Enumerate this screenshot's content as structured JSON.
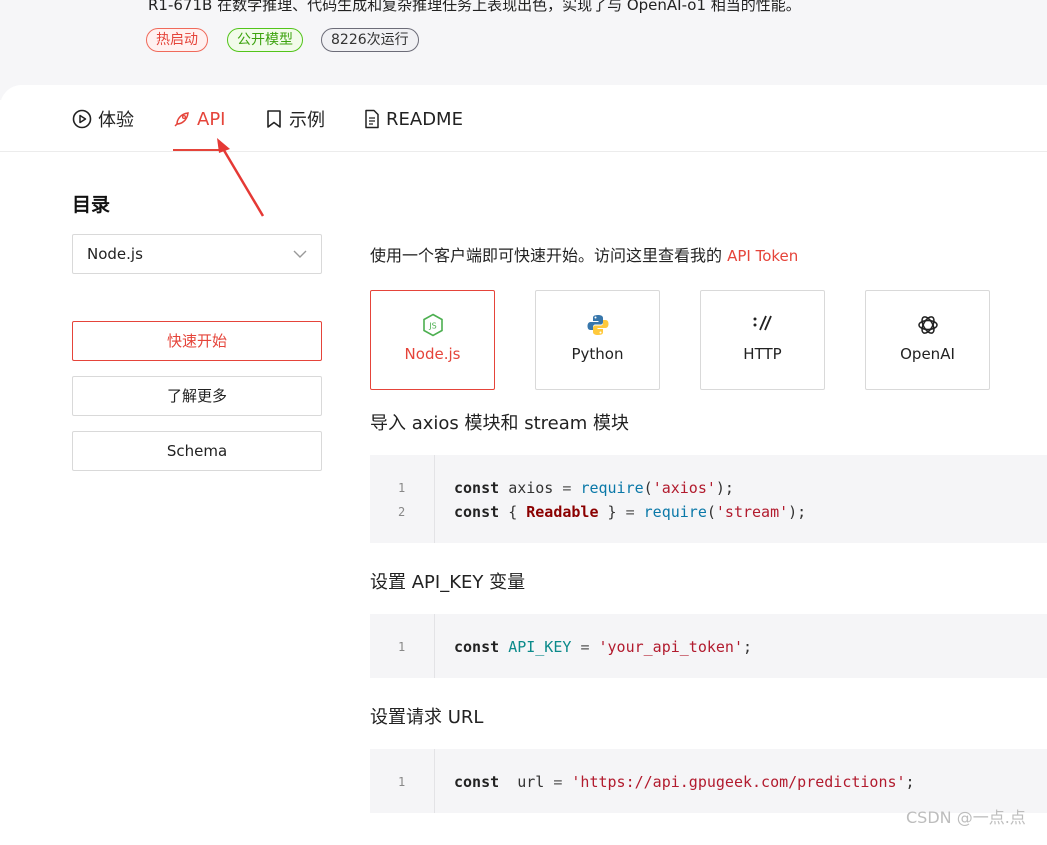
{
  "header": {
    "description": "R1-671B 在数学推理、代码生成和复杂推理任务上表现出色，实现了与 OpenAI-o1 相当的性能。",
    "badges": [
      "热启动",
      "公开模型",
      "8226次运行"
    ]
  },
  "tabs": [
    {
      "label": "体验",
      "icon": "play-circle-icon"
    },
    {
      "label": "API",
      "icon": "rocket-icon",
      "active": true
    },
    {
      "label": "示例",
      "icon": "bookmark-icon"
    },
    {
      "label": "README",
      "icon": "document-icon"
    }
  ],
  "sidebar": {
    "title": "目录",
    "select_value": "Node.js",
    "items": [
      "快速开始",
      "了解更多",
      "Schema"
    ]
  },
  "main": {
    "intro": "使用一个客户端即可快速开始。访问这里查看我的",
    "intro_link": "API Token",
    "languages": [
      {
        "label": "Node.js",
        "icon": "nodejs-icon",
        "active": true
      },
      {
        "label": "Python",
        "icon": "python-icon"
      },
      {
        "label": "HTTP",
        "icon": "http-icon"
      },
      {
        "label": "OpenAI",
        "icon": "openai-icon"
      }
    ],
    "sections": [
      {
        "title": "导入 axios 模块和 stream 模块",
        "lines": [
          [
            [
              "kw",
              "const"
            ],
            [
              "",
              "axios "
            ],
            [
              "op",
              "= "
            ],
            [
              "fn",
              "require"
            ],
            [
              "",
              "("
            ],
            [
              "str",
              "'axios'"
            ],
            [
              "",
              ");"
            ]
          ],
          [
            [
              "kw",
              "const"
            ],
            [
              "",
              "{ "
            ],
            [
              "cls",
              "Readable"
            ],
            [
              "",
              " } "
            ],
            [
              "op",
              "= "
            ],
            [
              "fn",
              "require"
            ],
            [
              "",
              "("
            ],
            [
              "str",
              "'stream'"
            ],
            [
              "",
              ");"
            ]
          ]
        ]
      },
      {
        "title": "设置 API_KEY 变量",
        "lines": [
          [
            [
              "kw",
              "const"
            ],
            [
              "const",
              "API_KEY"
            ],
            [
              "",
              " "
            ],
            [
              "op",
              "= "
            ],
            [
              "str",
              "'your_api_token'"
            ],
            [
              "",
              ";"
            ]
          ]
        ]
      },
      {
        "title": "设置请求 URL",
        "lines": [
          [
            [
              "kw",
              "const"
            ],
            [
              "",
              " url "
            ],
            [
              "op",
              "= "
            ],
            [
              "str",
              "'https://api.gpugeek.com/predictions'"
            ],
            [
              "",
              ";"
            ]
          ]
        ]
      }
    ]
  },
  "watermark": "CSDN @一点.点",
  "colors": {
    "accent": "#e5443a",
    "success": "#52c41a",
    "background": "#f6f6f8"
  }
}
